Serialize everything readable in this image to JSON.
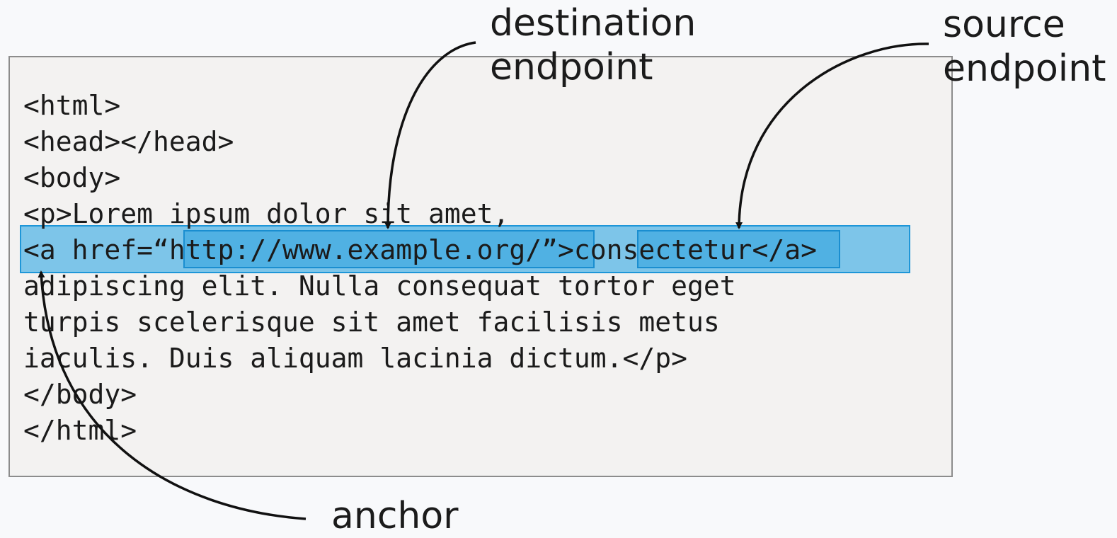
{
  "code_lines": [
    "<html>",
    "<head></head>",
    "<body>",
    "<p>Lorem ipsum dolor sit amet,",
    "<a href=“http://www.example.org/”>consectetur</a>",
    "adipiscing elit. Nulla consequat tortor eget",
    "turpis scelerisque sit amet facilisis metus",
    "iaculis. Duis aliquam lacinia dictum.</p>",
    "</body>",
    "</html>"
  ],
  "labels": {
    "destination": "destination\nendpoint",
    "source": "source\nendpoint",
    "anchor": "anchor"
  },
  "colors": {
    "highlight": "#34aae3",
    "highlight_border": "#1e96d8",
    "panel": "#f3f2f1",
    "arrow": "#111111"
  }
}
